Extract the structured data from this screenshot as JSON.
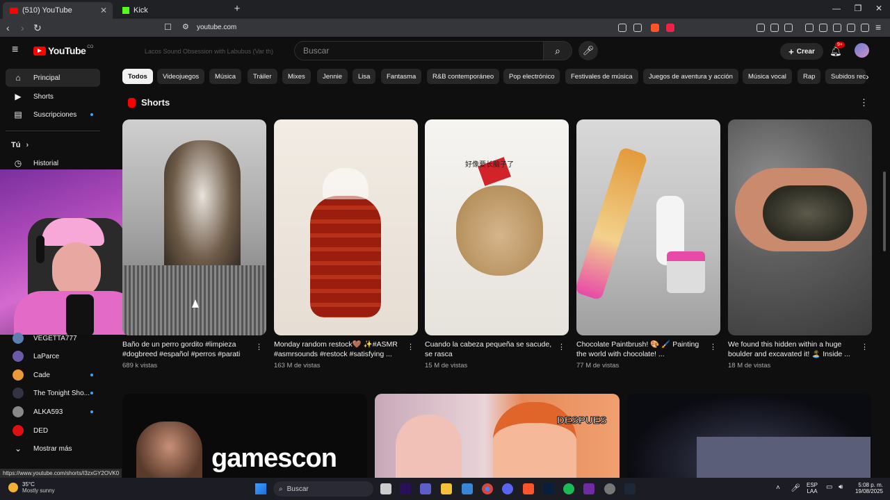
{
  "browser": {
    "tabs": [
      {
        "label": "(510) YouTube",
        "active": true
      },
      {
        "label": "Kick",
        "active": false
      }
    ],
    "url": "youtube.com",
    "status_url": "https://www.youtube.com/shorts/I3zxGY2OVK0"
  },
  "header": {
    "logo_text": "YouTube",
    "logo_region": "CO",
    "search_placeholder": "Buscar",
    "create_label": "Crear",
    "notif_badge": "9+",
    "overlay_text": "Lacos Sound Obsession with Labubus (Var th)"
  },
  "sidebar": {
    "top_items": [
      {
        "label": "Principal",
        "icon": "home-icon"
      },
      {
        "label": "Shorts",
        "icon": "shorts-icon"
      },
      {
        "label": "Suscripciones",
        "icon": "subscriptions-icon"
      }
    ],
    "you_label": "Tú",
    "history_label": "Historial",
    "subscriptions": [
      {
        "label": "VEGETTA777"
      },
      {
        "label": "LaParce"
      },
      {
        "label": "Cade"
      },
      {
        "label": "The Tonight Sho..."
      },
      {
        "label": "ALKA593"
      },
      {
        "label": "DED"
      }
    ],
    "more_label": "Mostrar más"
  },
  "chips": [
    "Todos",
    "Videojuegos",
    "Música",
    "Tráiler",
    "Mixes",
    "Jennie",
    "Lisa",
    "Fantasma",
    "R&B contemporáneo",
    "Pop electrónico",
    "Festivales de música",
    "Juegos de aventura y acción",
    "Música vocal",
    "Rap",
    "Subidos rec"
  ],
  "shorts_section": {
    "title": "Shorts",
    "items": [
      {
        "title": "Baño de un perro gordito #limpieza #dogbreed #español #perros #parati",
        "views": "689 k vistas"
      },
      {
        "title": "Monday random restock🤎 ✨#ASMR #asmrsounds #restock #satisfying ...",
        "views": "163 M de vistas"
      },
      {
        "title": "Cuando la cabeza pequeña se sacude, se rasca",
        "views": "15 M de vistas",
        "overlay": "好像要长脑子了"
      },
      {
        "title": "Chocolate Paintbrush! 🎨 🖌️ Painting the world with chocolate! ...",
        "views": "77 M de vistas"
      },
      {
        "title": "We found this hidden within a huge boulder and excavated it! 🏝️ Inside ...",
        "views": "18 M de vistas"
      }
    ]
  },
  "videos": {
    "items": [
      {
        "thumb_text": "gamescon"
      },
      {
        "thumb_text": "DESPUES"
      },
      {
        "thumb_text": ""
      }
    ]
  },
  "taskbar": {
    "weather_temp": "35°C",
    "weather_desc": "Mostly sunny",
    "search_label": "Buscar",
    "lang": "ESP",
    "lang_sub": "LAA",
    "time": "5:08 p. m.",
    "date": "19/08/2025"
  },
  "colors": {
    "bg": "#0f0f0f",
    "yt_red": "#ff0000",
    "chip_bg": "#272727",
    "accent_blue": "#3ea6ff"
  }
}
